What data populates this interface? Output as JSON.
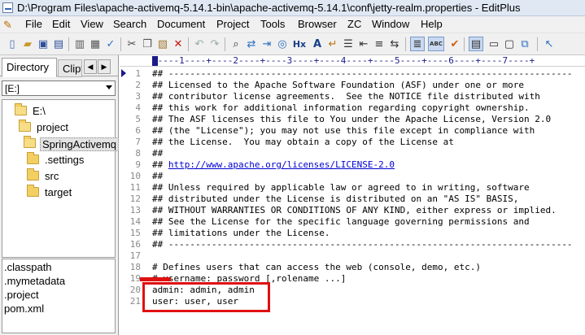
{
  "window": {
    "title": "D:\\Program Files\\apache-activemq-5.14.1-bin\\apache-activemq-5.14.1\\conf\\jetty-realm.properties - EditPlus"
  },
  "menubar": {
    "items": [
      "File",
      "Edit",
      "View",
      "Search",
      "Document",
      "Project",
      "Tools",
      "Browser",
      "ZC",
      "Window",
      "Help"
    ]
  },
  "toolbar": {
    "icons": [
      "new-file-icon",
      "open-icon",
      "save-icon",
      "save-all-icon",
      "print-icon",
      "print-preview-icon",
      "spell-check-icon",
      "cut-icon",
      "copy-icon",
      "paste-icon",
      "delete-icon",
      "undo-icon",
      "redo-icon",
      "find-icon",
      "replace-icon",
      "goto-icon",
      "browser-icon",
      "hex-icon",
      "font-icon",
      "word-wrap-icon",
      "ruler-icon",
      "spellcheck-toggle-icon",
      "check-icon",
      "directory-icon",
      "output-icon",
      "screen-icon",
      "help-icon"
    ],
    "hex_label": "Hx",
    "abc_label": "ABC"
  },
  "sidebar": {
    "tabs": [
      "Directory",
      "Clipt"
    ],
    "drive": "[E:]",
    "tree": [
      {
        "label": "E:\\",
        "open": true
      },
      {
        "label": "project",
        "open": true
      },
      {
        "label": "SpringActivemq",
        "open": true,
        "selected": true
      },
      {
        "label": ".settings",
        "open": false
      },
      {
        "label": "src",
        "open": false
      },
      {
        "label": "target",
        "open": false
      }
    ],
    "files": [
      ".classpath",
      ".mymetadata",
      ".project",
      "pom.xml"
    ]
  },
  "editor": {
    "ruler": "+----1----+----2----+----3----+----4----+----5----+----6----+----7----+",
    "lines": [
      {
        "n": "1",
        "text": "## ---------------------------------------------------------------------------"
      },
      {
        "n": "2",
        "text": "## Licensed to the Apache Software Foundation (ASF) under one or more"
      },
      {
        "n": "3",
        "text": "## contributor license agreements.  See the NOTICE file distributed with"
      },
      {
        "n": "4",
        "text": "## this work for additional information regarding copyright ownership."
      },
      {
        "n": "5",
        "text": "## The ASF licenses this file to You under the Apache License, Version 2.0"
      },
      {
        "n": "6",
        "text": "## (the \"License\"); you may not use this file except in compliance with"
      },
      {
        "n": "7",
        "text": "## the License.  You may obtain a copy of the License at"
      },
      {
        "n": "8",
        "text": "##"
      },
      {
        "n": "9",
        "text": "## ",
        "link": "http://www.apache.org/licenses/LICENSE-2.0"
      },
      {
        "n": "10",
        "text": "##"
      },
      {
        "n": "11",
        "text": "## Unless required by applicable law or agreed to in writing, software"
      },
      {
        "n": "12",
        "text": "## distributed under the License is distributed on an \"AS IS\" BASIS,"
      },
      {
        "n": "13",
        "text": "## WITHOUT WARRANTIES OR CONDITIONS OF ANY KIND, either express or implied."
      },
      {
        "n": "14",
        "text": "## See the License for the specific language governing permissions and"
      },
      {
        "n": "15",
        "text": "## limitations under the License."
      },
      {
        "n": "16",
        "text": "## ---------------------------------------------------------------------------"
      },
      {
        "n": "17",
        "text": ""
      },
      {
        "n": "18",
        "text": "# Defines users that can access the web (console, demo, etc.)"
      },
      {
        "n": "19",
        "text": "# username: password [,rolename ...]"
      },
      {
        "n": "20",
        "text": "admin: admin, admin"
      },
      {
        "n": "21",
        "text": "user: user, user"
      }
    ]
  },
  "colors": {
    "annotation": "#e01010",
    "link": "#0000d0",
    "ruler": "#1a1a8a"
  }
}
